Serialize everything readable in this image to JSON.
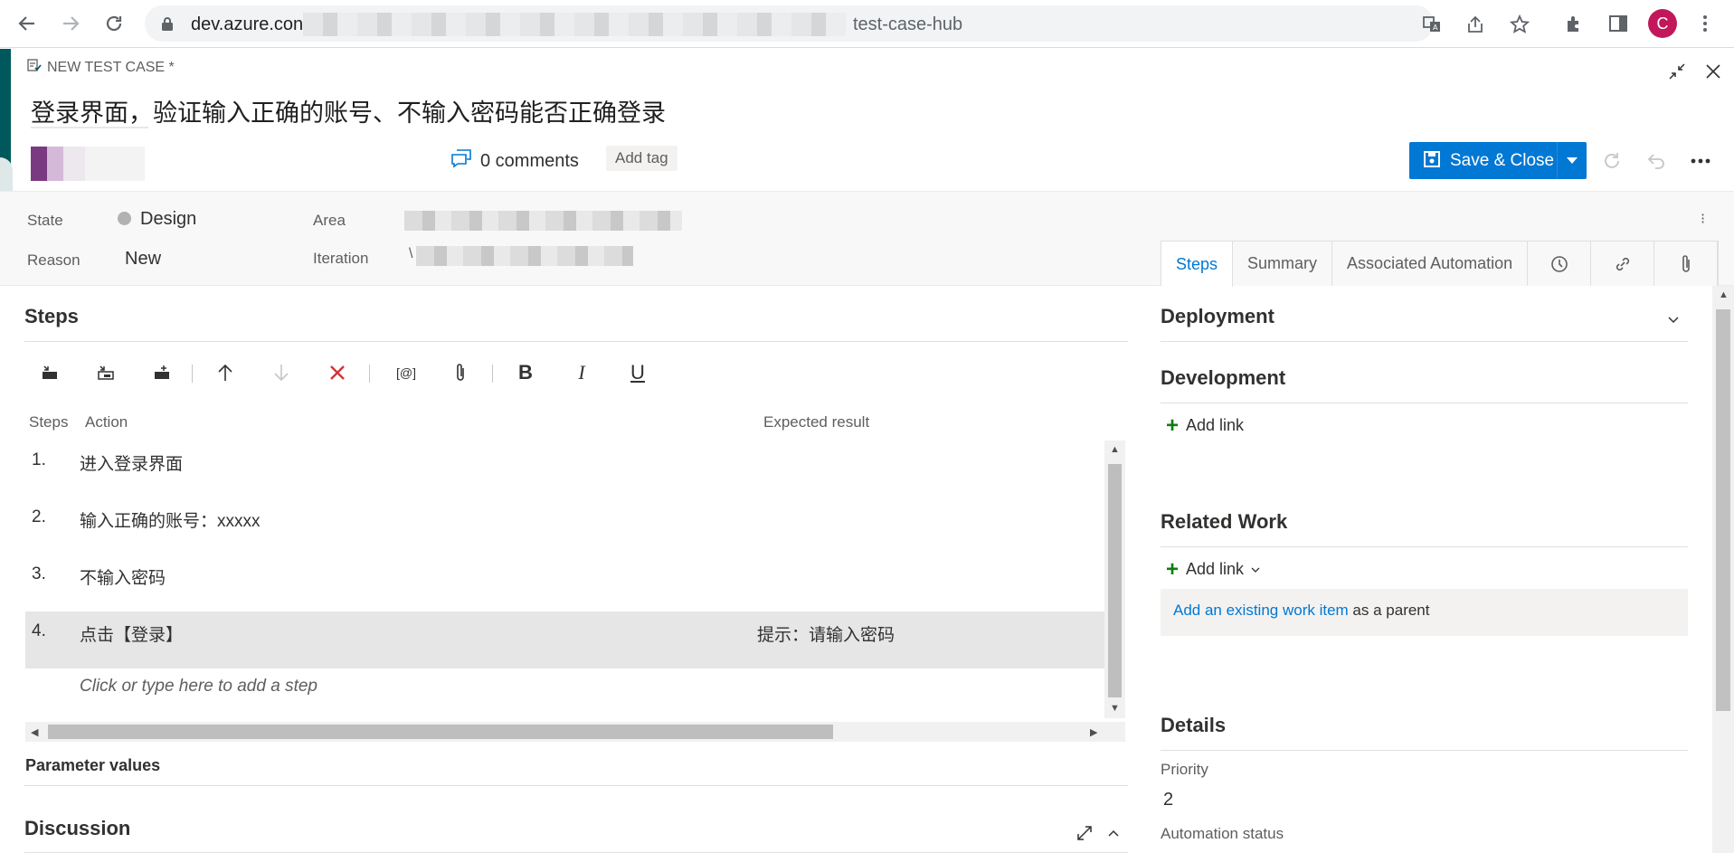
{
  "browser": {
    "url_start": "dev.azure.con",
    "url_end": "test-case-hub",
    "avatar_letter": "C"
  },
  "workitem": {
    "type_label": "NEW TEST CASE *",
    "title": "登录界面，验证输入正确的账号、不输入密码能否正确登录",
    "comments": "0 comments",
    "add_tag": "Add tag",
    "save_close": "Save & Close"
  },
  "fields": {
    "state_label": "State",
    "state_value": "Design",
    "reason_label": "Reason",
    "reason_value": "New",
    "area_label": "Area",
    "iteration_label": "Iteration",
    "iteration_value_prefix": "\\"
  },
  "tabs": [
    {
      "label": "Steps",
      "active": true
    },
    {
      "label": "Summary"
    },
    {
      "label": "Associated Automation"
    }
  ],
  "steps_section": {
    "title": "Steps",
    "col_steps": "Steps",
    "col_action": "Action",
    "col_expected": "Expected result",
    "rows": [
      {
        "num": "1.",
        "action": "进入登录界面",
        "expected": ""
      },
      {
        "num": "2.",
        "action": "输入正确的账号：xxxxx",
        "expected": ""
      },
      {
        "num": "3.",
        "action": "不输入密码",
        "expected": ""
      },
      {
        "num": "4.",
        "action": "点击【登录】",
        "expected": "提示：请输入密码"
      }
    ],
    "add_step": "Click or type here to add a step",
    "toolbar": [
      "insert-step-icon",
      "insert-shared-steps-icon",
      "insert-parameter-icon",
      "move-up-icon",
      "move-down-icon",
      "delete-icon",
      "shared-params-icon",
      "attach-icon",
      "bold-icon",
      "italic-icon",
      "underline-icon"
    ],
    "toolbar_text": {
      "params": "[@]",
      "bold": "B",
      "italic": "I",
      "underline": "U"
    }
  },
  "parameter_values": "Parameter values",
  "discussion": "Discussion",
  "right": {
    "deployment": "Deployment",
    "development": "Development",
    "dev_add_link": "Add link",
    "related_work": "Related Work",
    "related_add_link": "Add link",
    "add_existing_link": "Add an existing work item",
    "add_existing_rest": " as a parent",
    "details": "Details",
    "priority_label": "Priority",
    "priority_value": "2",
    "automation_label": "Automation status"
  }
}
